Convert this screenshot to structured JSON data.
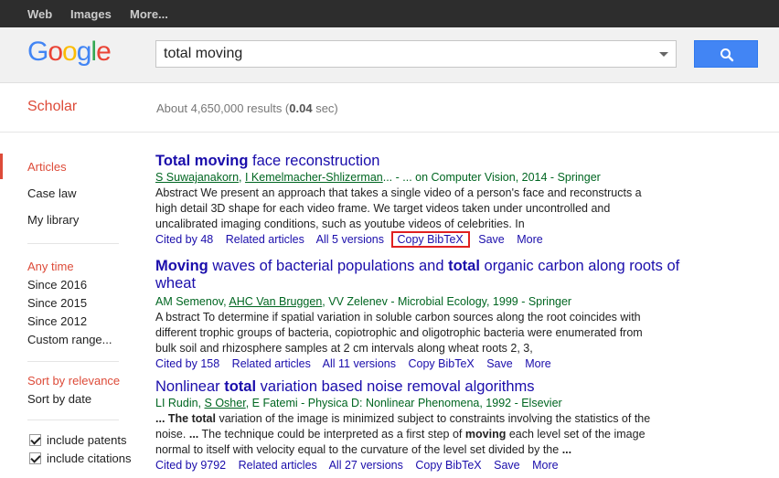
{
  "topbar": {
    "links": [
      "Web",
      "Images",
      "More..."
    ]
  },
  "logo": {
    "letters": [
      {
        "ch": "G",
        "color": "#4285f4"
      },
      {
        "ch": "o",
        "color": "#ea4335"
      },
      {
        "ch": "o",
        "color": "#fbbc05"
      },
      {
        "ch": "g",
        "color": "#4285f4"
      },
      {
        "ch": "l",
        "color": "#34a853"
      },
      {
        "ch": "e",
        "color": "#ea4335"
      }
    ]
  },
  "search": {
    "query": "total moving",
    "button_icon": "search-icon"
  },
  "subbar": {
    "title": "Scholar",
    "results_prefix": "About 4,650,000 results (",
    "results_time": "0.04",
    "results_suffix": " sec)"
  },
  "sidebar": {
    "types": [
      "Articles",
      "Case law",
      "My library"
    ],
    "times": [
      "Any time",
      "Since 2016",
      "Since 2015",
      "Since 2012",
      "Custom range..."
    ],
    "sorts": [
      "Sort by relevance",
      "Sort by date"
    ],
    "checkboxes": [
      "include patents",
      "include citations"
    ]
  },
  "results": [
    {
      "title_bold": "Total moving",
      "title_rest": " face reconstruction",
      "authors": [
        "S Suwajanakorn",
        "I Kemelmacher-Shlizerman"
      ],
      "source": "... - ... on Computer Vision, 2014 - Springer",
      "snippet": "Abstract We present an approach that takes a single video of a person's face and reconstructs a high detail 3D shape for each video frame. We target videos taken under uncontrolled and uncalibrated imaging conditions, such as youtube videos of celebrities. In",
      "links": [
        "Cited by 48",
        "Related articles",
        "All 5 versions",
        "Copy BibTeX",
        "Save",
        "More"
      ]
    },
    {
      "title_parts": [
        [
          "Moving",
          true
        ],
        [
          " waves of bacterial populations and ",
          false
        ],
        [
          "total",
          true
        ],
        [
          " organic carbon along roots of wheat",
          false
        ]
      ],
      "authors_plain": "AM Semenov, ",
      "author_link": "AHC Van Bruggen",
      "source": ", VV Zelenev - Microbial Ecology, 1999 - Springer",
      "snippet": "A bstract To determine if spatial variation in soluble carbon sources along the root coincides with different trophic groups of bacteria, copiotrophic and oligotrophic bacteria were enumerated from bulk soil and rhizosphere samples at 2 cm intervals along wheat roots 2, 3,",
      "links": [
        "Cited by 158",
        "Related articles",
        "All 11 versions",
        "Copy BibTeX",
        "Save",
        "More"
      ]
    },
    {
      "title_parts": [
        [
          "Nonlinear ",
          false
        ],
        [
          "total",
          true
        ],
        [
          " variation based noise removal algorithms",
          false
        ]
      ],
      "authors_plain": "LI Rudin, ",
      "author_link": "S Osher",
      "source": ", E Fatemi - Physica D: Nonlinear Phenomena, 1992 - Elsevier",
      "snippet_parts": [
        [
          "... The ",
          false
        ],
        [
          "total",
          true
        ],
        [
          " variation of the image is minimized subject to constraints involving the statistics of the noise. ",
          false
        ],
        [
          "...",
          true
        ],
        [
          " The technique could be interpreted as a first step of ",
          false
        ],
        [
          "moving",
          true
        ],
        [
          " each level set of the image normal to itself with velocity equal to the curvature of the level set divided by the ",
          false
        ],
        [
          "...",
          true
        ]
      ],
      "links": [
        "Cited by 9792",
        "Related articles",
        "All 27 versions",
        "Copy BibTeX",
        "Save",
        "More"
      ]
    }
  ]
}
